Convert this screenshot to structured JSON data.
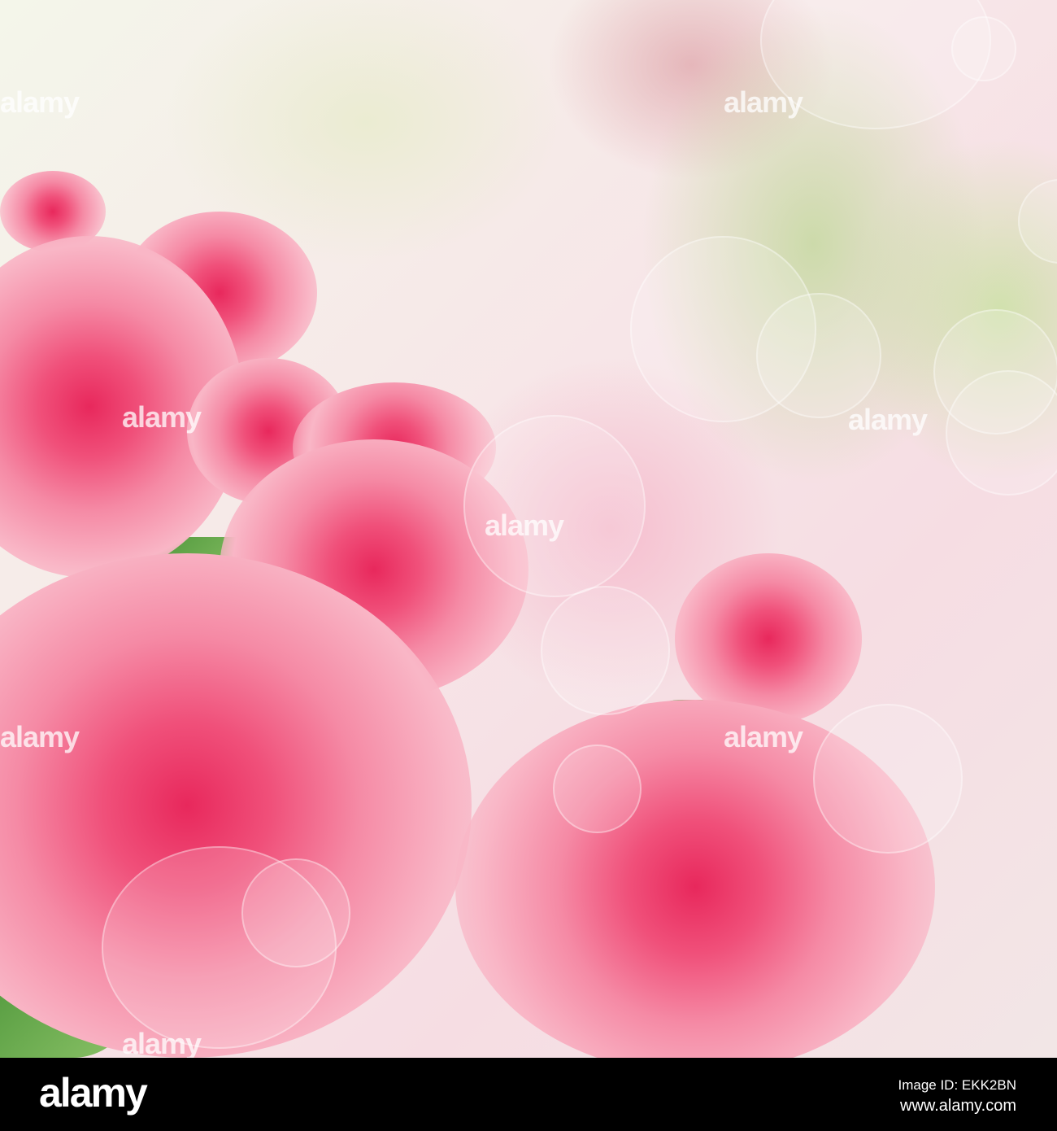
{
  "photo": {
    "subject": "pink-roses",
    "watermark": "alamy",
    "colors": {
      "rose": "#f0507a",
      "rose_deep": "#e8285c",
      "leaf": "#3d8a2e",
      "background": "#f6e6e8"
    }
  },
  "footer": {
    "logo": "alamy",
    "image_id": "Image ID: EKK2BN",
    "url": "www.alamy.com"
  }
}
